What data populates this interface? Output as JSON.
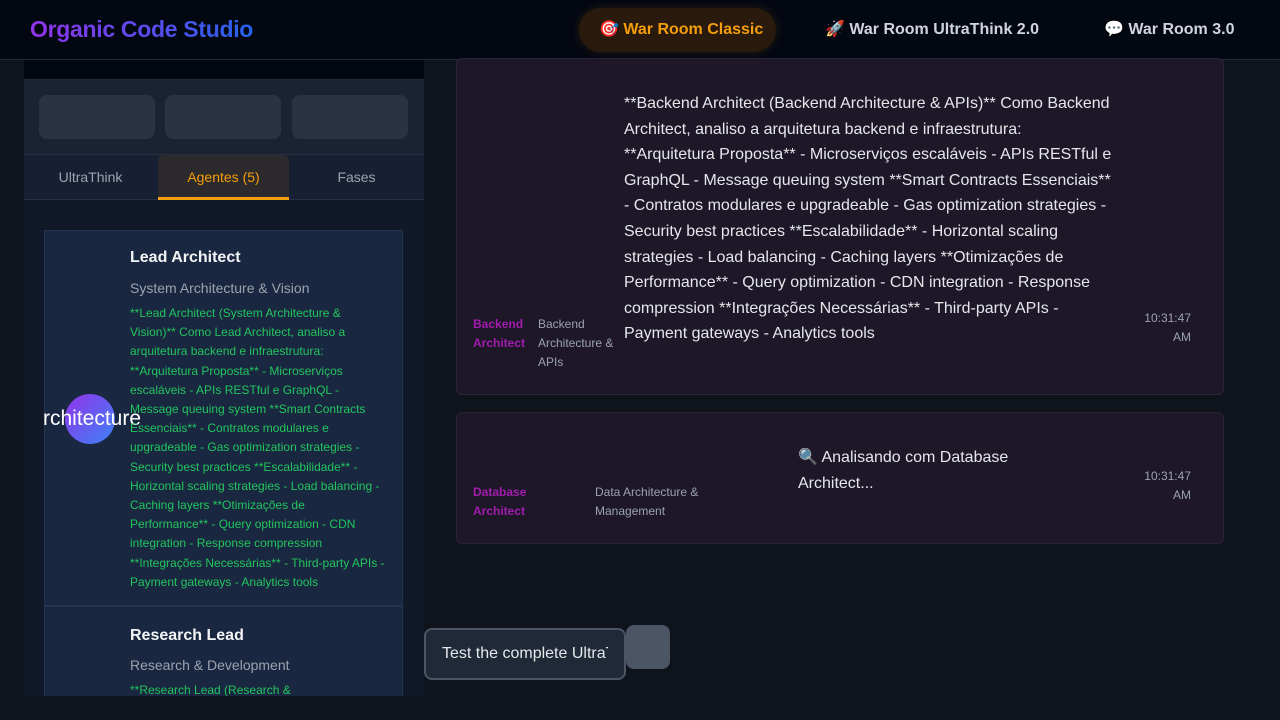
{
  "brand": "Organic Code Studio",
  "nav": [
    {
      "icon": "🎯",
      "label": "War Room Classic",
      "active": true
    },
    {
      "icon": "🚀",
      "label": "War Room UltraThink 2.0"
    },
    {
      "icon": "💬",
      "label": "War Room 3.0"
    }
  ],
  "tabs": [
    {
      "label": "UltraThink"
    },
    {
      "label": "Agentes (5)",
      "active": true
    },
    {
      "label": "Fases"
    }
  ],
  "agents": [
    {
      "avatar_text": "rchitecture",
      "name": "Lead Architect",
      "role": "System Architecture & Vision",
      "output": "**Lead Architect (System Architecture & Vision)** Como Lead Architect, analiso a arquitetura backend e infraestrutura: **Arquitetura Proposta** - Microserviços escaláveis - APIs RESTful e GraphQL - Message queuing system **Smart Contracts Essenciais** - Contratos modulares e upgradeable - Gas optimization strategies - Security best practices **Escalabilidade** - Horizontal scaling strategies - Load balancing - Caching layers **Otimizações de Performance** - Query optimization - CDN integration - Response compression **Integrações Necessárias** - Third-party APIs - Payment gateways - Analytics tools"
    },
    {
      "name": "Research Lead",
      "role": "Research & Development",
      "output": "**Research Lead (Research &"
    }
  ],
  "messages": [
    {
      "name": "Backend Architect",
      "role": "Backend Architecture & APIs",
      "text": "**Backend Architect (Backend Architecture & APIs)** Como Backend Architect, analiso a arquitetura backend e infraestrutura: **Arquitetura Proposta** - Microserviços escaláveis - APIs RESTful e GraphQL - Message queuing system **Smart Contracts Essenciais** - Contratos modulares e upgradeable - Gas optimization strategies - Security best practices **Escalabilidade** - Horizontal scaling strategies - Load balancing - Caching layers **Otimizações de Performance** - Query optimization - CDN integration - Response compression **Integrações Necessárias** - Third-party APIs - Payment gateways - Analytics tools",
      "time": "10:31:47 AM"
    },
    {
      "name": "Database Architect",
      "role": "Data Architecture & Management",
      "text": "🔍 Analisando com Database Architect...",
      "time": "10:31:47 AM"
    }
  ],
  "input": {
    "value": "Test the complete UltraThink"
  }
}
